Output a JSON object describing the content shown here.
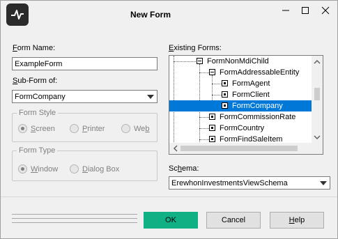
{
  "window": {
    "title": "New Form"
  },
  "form_name": {
    "label_pre": "F",
    "label_rest": "orm Name:",
    "value": "ExampleForm"
  },
  "sub_form": {
    "label_pre": "S",
    "label_rest": "ub-Form of:",
    "value": "FormCompany"
  },
  "form_style": {
    "legend": "Form Style",
    "options": [
      {
        "pre": "S",
        "rest": "creen",
        "selected": true
      },
      {
        "pre": "P",
        "rest": "rinter",
        "selected": false
      },
      {
        "pre": "We",
        "mid": "b",
        "rest": "",
        "selected": false
      }
    ]
  },
  "form_type": {
    "legend": "Form Type",
    "options": [
      {
        "pre": "W",
        "rest": "indow",
        "selected": true
      },
      {
        "pre": "D",
        "rest": "ialog Box",
        "selected": false
      }
    ]
  },
  "existing_forms": {
    "label_pre": "E",
    "label_rest": "xisting Forms:",
    "items": [
      {
        "text": "FormNonMdiChild",
        "type": "expanded"
      },
      {
        "text": "FormAddressableEntity",
        "type": "expanded"
      },
      {
        "text": "FormAgent",
        "type": "leaf"
      },
      {
        "text": "FormClient",
        "type": "leaf"
      },
      {
        "text": "FormCompany",
        "type": "leaf",
        "selected": true
      },
      {
        "text": "FormCommissionRate",
        "type": "leaf"
      },
      {
        "text": "FormCountry",
        "type": "leaf"
      },
      {
        "text": "FormFindSaleItem",
        "type": "leaf"
      }
    ]
  },
  "schema": {
    "label_pre": "Sc",
    "label_mid": "h",
    "label_rest": "ema:",
    "value": "ErewhonInvestmentsViewSchema"
  },
  "buttons": {
    "ok": "OK",
    "cancel": "Cancel",
    "help_pre": "H",
    "help_rest": "elp"
  },
  "colors": {
    "accent": "#10b085",
    "selection": "#0078d7"
  }
}
